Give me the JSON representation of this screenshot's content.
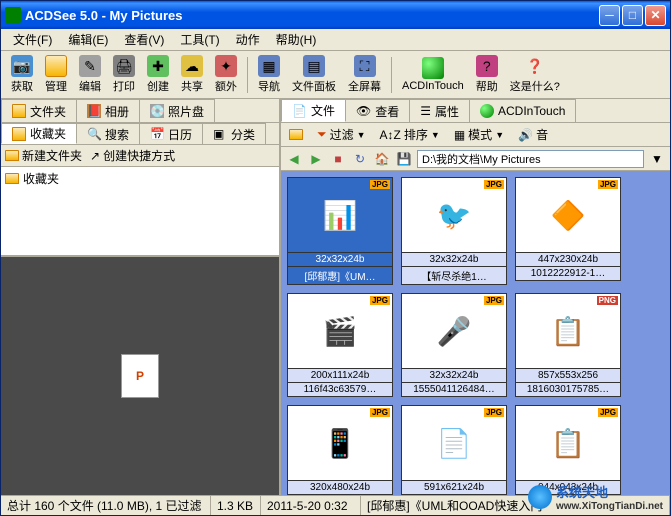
{
  "window": {
    "title": "ACDSee 5.0 - My Pictures"
  },
  "menu": {
    "file": "文件(F)",
    "edit": "编辑(E)",
    "view": "查看(V)",
    "tools": "工具(T)",
    "action": "动作",
    "help": "帮助(H)"
  },
  "toolbar": {
    "acquire": "获取",
    "manage": "管理",
    "edit": "编辑",
    "print": "打印",
    "create": "创建",
    "share": "共享",
    "extra": "额外",
    "nav": "导航",
    "filepanel": "文件面板",
    "fullscreen": "全屏幕",
    "intouch": "ACDInTouch",
    "help": "帮助",
    "whatsthis": "这是什么?"
  },
  "lefttabs1": {
    "folders": "文件夹",
    "albums": "相册",
    "photodisk": "照片盘"
  },
  "lefttabs2": {
    "favorites": "收藏夹",
    "search": "搜索",
    "calendar": "日历",
    "categories": "分类"
  },
  "leftbar": {
    "newfolder": "新建文件夹",
    "shortcut": "创建快捷方式"
  },
  "favorites": {
    "item1": "收藏夹"
  },
  "righttabs": {
    "files": "文件",
    "view": "查看",
    "properties": "属性",
    "intouch": "ACDInTouch"
  },
  "filterbar": {
    "filter": "过滤",
    "sort": "排序",
    "mode": "模式",
    "sound": "音"
  },
  "pathbar": {
    "path": "D:\\我的文档\\My Pictures"
  },
  "thumbs": [
    {
      "dims": "32x32x24b",
      "name": "[邱郁惠]《UM…",
      "badge": "JPG",
      "selected": true
    },
    {
      "dims": "32x32x24b",
      "name": "【斩尽杀绝1…",
      "badge": "JPG"
    },
    {
      "dims": "447x230x24b",
      "name": "1012222912-1…",
      "badge": "JPG"
    },
    {
      "dims": "200x111x24b",
      "name": "116f43c63579…",
      "badge": "JPG"
    },
    {
      "dims": "32x32x24b",
      "name": "1555041126484…",
      "badge": "JPG"
    },
    {
      "dims": "857x553x256",
      "name": "1816030175785…",
      "badge": "PNG"
    },
    {
      "dims": "320x480x24b",
      "name": "",
      "badge": "JPG"
    },
    {
      "dims": "591x621x24b",
      "name": "",
      "badge": "JPG"
    },
    {
      "dims": "044x043x24b",
      "name": "",
      "badge": "JPG"
    }
  ],
  "status": {
    "total": "总计 160 个文件 (11.0 MB), 1 已过滤",
    "size": "1.3 KB",
    "date": "2011-5-20 0:32",
    "file": "[邱郁惠]《UML和OOAD快速入门"
  },
  "watermark": {
    "line1": "系统天地",
    "line2": "www.XiTongTianDi.net"
  }
}
